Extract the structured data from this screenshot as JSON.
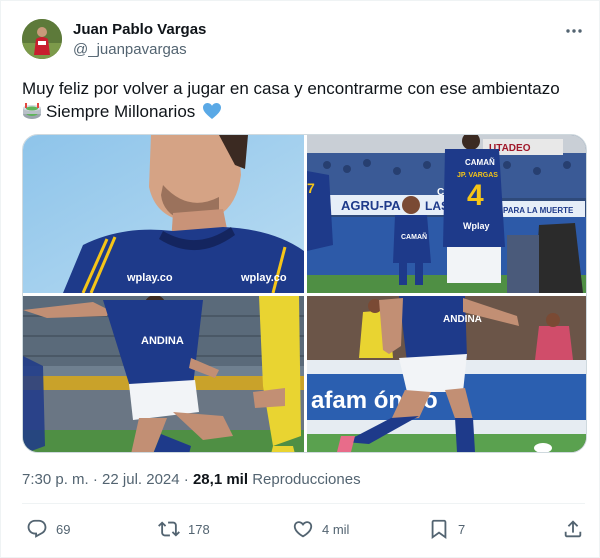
{
  "author": {
    "name": "Juan Pablo Vargas",
    "handle": "@_juanpavargas",
    "avatar": "profile-photo"
  },
  "tweet": {
    "text_line1": "Muy feliz por volver a jugar en casa y encontrarme con ese ambientazo",
    "text_line2": "Siempre Millonarios",
    "emoji_stadium": "stadium-icon",
    "emoji_heart": "blue-heart-icon"
  },
  "media": {
    "photo1": {
      "sponsor": "wplay.co"
    },
    "photo2": {
      "shirt_name": "JP. VARGAS",
      "shirt_number": "4",
      "shirt_brand": "CAMAÑ",
      "sponsor": "Wplay",
      "banner1": "AGRU-PA",
      "banner2": "UTADEO",
      "banner3": "PARA LA MUERTE",
      "banner4": "LAS",
      "banner5": "CIA"
    },
    "photo3": {
      "shirt_brand": "ANDINA"
    },
    "photo4": {
      "shirt_brand": "ANDINA",
      "board": "afam   ónico"
    }
  },
  "meta": {
    "time": "7:30 p. m.",
    "separator": "·",
    "date": "22 jul. 2024",
    "views": "28,1 mil",
    "views_label": "Reproducciones"
  },
  "actions": {
    "replies": "69",
    "reposts": "178",
    "likes": "4 mil",
    "bookmarks": "7"
  },
  "colors": {
    "text": "#0f1419",
    "secondary": "#536471",
    "heart_blue": "#5aa9e6",
    "kit_blue": "#1e3a8a"
  }
}
